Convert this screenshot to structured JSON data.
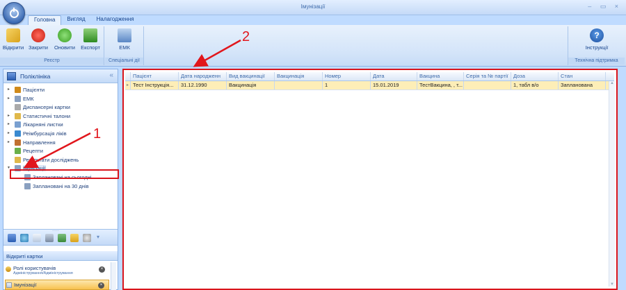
{
  "window": {
    "title": "Імунізації",
    "controls": "– ▭ ×"
  },
  "tabs": [
    "Головна",
    "Вигляд",
    "Налагодження"
  ],
  "ribbon": {
    "groups": [
      {
        "label": "Реєстр",
        "buttons": [
          {
            "label": "Відкрити",
            "icon": "folder-open-icon"
          },
          {
            "label": "Закрити",
            "icon": "close-icon"
          },
          {
            "label": "Оновити",
            "icon": "refresh-icon"
          },
          {
            "label": "Експорт",
            "icon": "export-icon"
          }
        ]
      },
      {
        "label": "Спеціальні дії",
        "buttons": [
          {
            "label": "ЕМК",
            "icon": "emk-icon"
          }
        ]
      },
      {
        "label": "Технічна підтримка",
        "buttons": [
          {
            "label": "Інструкції",
            "icon": "help-icon"
          }
        ]
      }
    ]
  },
  "left_panel": {
    "title": "Поліклініка",
    "collapse": "«",
    "tree": [
      {
        "label": "Пацієнти",
        "level": 0,
        "arrow": "▸"
      },
      {
        "label": "ЕМК",
        "level": 0,
        "arrow": "▸"
      },
      {
        "label": "Диспансерні картки",
        "level": 0,
        "arrow": ""
      },
      {
        "label": "Статистичні талони",
        "level": 0,
        "arrow": "▸"
      },
      {
        "label": "Лікарняні листки",
        "level": 0,
        "arrow": "▸"
      },
      {
        "label": "Реімбурсація ліків",
        "level": 0,
        "arrow": "▸"
      },
      {
        "label": "Направлення",
        "level": 0,
        "arrow": "▸"
      },
      {
        "label": "Рецепти",
        "level": 0,
        "arrow": ""
      },
      {
        "label": "Результати досліджень",
        "level": 0,
        "arrow": ""
      },
      {
        "label": "Імунізації",
        "level": 0,
        "arrow": "▾"
      },
      {
        "label": "Заплановані на сьогодні",
        "level": 1,
        "arrow": ""
      },
      {
        "label": "Заплановані на 30 днів",
        "level": 1,
        "arrow": ""
      }
    ],
    "grip": "·····",
    "open_cards_title": "Відкриті картки",
    "open_cards": [
      {
        "title": "Ролі користувачів",
        "subtitle": "Адміністрування/Адміністрування"
      },
      {
        "title": "Імунізації",
        "subtitle": ""
      }
    ]
  },
  "grid": {
    "columns": [
      "Пацієнт",
      "Дата народженн",
      "Вид вакцинації",
      "Вакцинація",
      "Номер",
      "Дата",
      "Вакцина",
      "Серія та № партії",
      "Доза",
      "Стан"
    ],
    "rows": [
      [
        "Тест Інструкція...",
        "31.12.1990",
        "Вакцинація",
        "",
        "1",
        "15.01.2019",
        "ТестВакцина, , т...",
        "",
        "1, табл в/о",
        "Запланована"
      ]
    ]
  },
  "annotations": {
    "label1": "1",
    "label2": "2"
  }
}
